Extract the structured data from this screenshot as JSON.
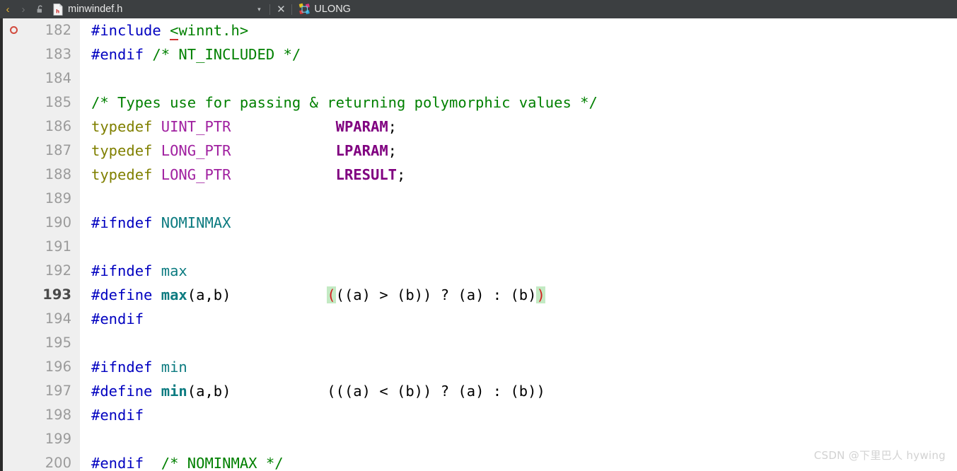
{
  "tabbar": {
    "back_label": "‹",
    "forward_label": "›",
    "lock_icon": "unlock-icon",
    "doc_icon": "header-file-icon",
    "title": "minwindef.h",
    "dropdown_label": "▾",
    "close_label": "✕",
    "symbol_icon": "class-symbol-icon",
    "symbol_name": "ULONG",
    "bg_color": "#3c3f41",
    "title_color": "#e8e8e8"
  },
  "editor": {
    "first_line": 182,
    "current_line": 193,
    "breakpoint_line": 182,
    "gutter_bg": "#efefef",
    "code_bg": "#ffffff",
    "match_highlight_bg": "#c3eac3",
    "match_highlight_fg": "#d42020",
    "lines": [
      {
        "n": "182",
        "breakpoint": true,
        "current": false,
        "tokens": [
          {
            "t": "#include ",
            "c": "pp"
          },
          {
            "t": "<",
            "c": "err-underline"
          },
          {
            "t": "winnt.h>",
            "c": "cmt"
          }
        ]
      },
      {
        "n": "183",
        "breakpoint": false,
        "current": false,
        "tokens": [
          {
            "t": "#endif ",
            "c": "pp"
          },
          {
            "t": "/* NT_INCLUDED */",
            "c": "cmt"
          }
        ]
      },
      {
        "n": "184",
        "breakpoint": false,
        "current": false,
        "tokens": []
      },
      {
        "n": "185",
        "breakpoint": false,
        "current": false,
        "tokens": [
          {
            "t": "/* Types use for passing & returning polymorphic values */",
            "c": "cmt"
          }
        ]
      },
      {
        "n": "186",
        "breakpoint": false,
        "current": false,
        "tokens": [
          {
            "t": "typedef ",
            "c": "kw"
          },
          {
            "t": "UINT_PTR",
            "c": "type"
          },
          {
            "t": "            ",
            "c": "plain"
          },
          {
            "t": "WPARAM",
            "c": "typedefname"
          },
          {
            "t": ";",
            "c": "plain"
          }
        ]
      },
      {
        "n": "187",
        "breakpoint": false,
        "current": false,
        "tokens": [
          {
            "t": "typedef ",
            "c": "kw"
          },
          {
            "t": "LONG_PTR",
            "c": "type"
          },
          {
            "t": "            ",
            "c": "plain"
          },
          {
            "t": "LPARAM",
            "c": "typedefname"
          },
          {
            "t": ";",
            "c": "plain"
          }
        ]
      },
      {
        "n": "188",
        "breakpoint": false,
        "current": false,
        "tokens": [
          {
            "t": "typedef ",
            "c": "kw"
          },
          {
            "t": "LONG_PTR",
            "c": "type"
          },
          {
            "t": "            ",
            "c": "plain"
          },
          {
            "t": "LRESULT",
            "c": "typedefname"
          },
          {
            "t": ";",
            "c": "plain"
          }
        ]
      },
      {
        "n": "189",
        "breakpoint": false,
        "current": false,
        "tokens": []
      },
      {
        "n": "190",
        "breakpoint": false,
        "current": false,
        "tokens": [
          {
            "t": "#ifndef ",
            "c": "pp"
          },
          {
            "t": "NOMINMAX",
            "c": "macro"
          }
        ]
      },
      {
        "n": "191",
        "breakpoint": false,
        "current": false,
        "tokens": []
      },
      {
        "n": "192",
        "breakpoint": false,
        "current": false,
        "tokens": [
          {
            "t": "#ifndef ",
            "c": "pp"
          },
          {
            "t": "max",
            "c": "macro"
          }
        ]
      },
      {
        "n": "193",
        "breakpoint": false,
        "current": true,
        "tokens": [
          {
            "t": "#define ",
            "c": "pp"
          },
          {
            "t": "max",
            "c": "macrodef"
          },
          {
            "t": "(a,b)",
            "c": "plain"
          },
          {
            "t": "           ",
            "c": "plain"
          },
          {
            "t": "(",
            "c": "match"
          },
          {
            "t": "((a) > (b)) ? (a) : (b)",
            "c": "plain"
          },
          {
            "t": ")",
            "c": "match"
          }
        ]
      },
      {
        "n": "194",
        "breakpoint": false,
        "current": false,
        "tokens": [
          {
            "t": "#endif",
            "c": "pp"
          }
        ]
      },
      {
        "n": "195",
        "breakpoint": false,
        "current": false,
        "tokens": []
      },
      {
        "n": "196",
        "breakpoint": false,
        "current": false,
        "tokens": [
          {
            "t": "#ifndef ",
            "c": "pp"
          },
          {
            "t": "min",
            "c": "macro"
          }
        ]
      },
      {
        "n": "197",
        "breakpoint": false,
        "current": false,
        "tokens": [
          {
            "t": "#define ",
            "c": "pp"
          },
          {
            "t": "min",
            "c": "macrodef"
          },
          {
            "t": "(a,b)",
            "c": "plain"
          },
          {
            "t": "           ",
            "c": "plain"
          },
          {
            "t": "(((a) < (b)) ? (a) : (b))",
            "c": "plain"
          }
        ]
      },
      {
        "n": "198",
        "breakpoint": false,
        "current": false,
        "tokens": [
          {
            "t": "#endif",
            "c": "pp"
          }
        ]
      },
      {
        "n": "199",
        "breakpoint": false,
        "current": false,
        "tokens": []
      },
      {
        "n": "200",
        "breakpoint": false,
        "current": false,
        "tokens": [
          {
            "t": "#endif  ",
            "c": "pp"
          },
          {
            "t": "/* NOMINMAX */",
            "c": "cmt"
          }
        ]
      }
    ]
  },
  "watermark": {
    "text": "CSDN @下里巴人 hywing",
    "color": "#d2d2d2"
  }
}
